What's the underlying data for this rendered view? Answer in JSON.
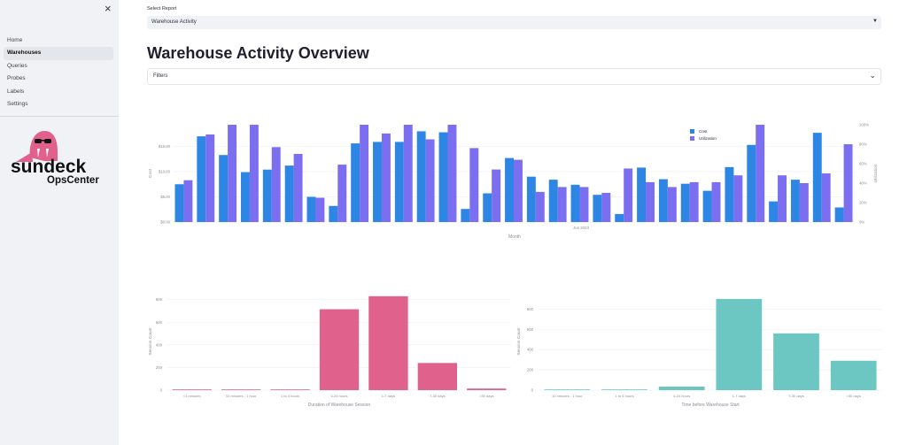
{
  "sidebar": {
    "items": [
      {
        "label": "Home",
        "active": false
      },
      {
        "label": "Warehouses",
        "active": true
      },
      {
        "label": "Queries",
        "active": false
      },
      {
        "label": "Probes",
        "active": false
      },
      {
        "label": "Labels",
        "active": false
      },
      {
        "label": "Settings",
        "active": false
      }
    ],
    "close_icon": "close-icon",
    "logo_word": "sundeck",
    "logo_sub": "OpsCenter"
  },
  "report": {
    "select_label": "Select Report",
    "selected": "Warehouse Activity"
  },
  "page_title": "Warehouse Activity Overview",
  "filters_label": "Filters",
  "colors": {
    "cost": "#2e86e4",
    "utilization": "#7b6ef0",
    "duration": "#e0618b",
    "start": "#6cc6c2",
    "grid": "#eceef2",
    "axis_text": "#8a8d96"
  },
  "chart_data": [
    {
      "type": "bar",
      "xlabel": "Month",
      "x_tick_label": "Jun 2023",
      "ylabel": "Cost",
      "y2label": "Utilization",
      "ylim": [
        0,
        19.3
      ],
      "y_ticks": [
        "$0.00",
        "$5.00",
        "$10.00",
        "$15.00"
      ],
      "y2lim": [
        0,
        100
      ],
      "y2_ticks": [
        "0%",
        "20%",
        "40%",
        "60%",
        "80%",
        "100%"
      ],
      "legend_position": "top-right",
      "series": [
        {
          "name": "Cost",
          "axis": "y",
          "values": [
            7.5,
            17.0,
            13.3,
            9.9,
            10.4,
            11.2,
            5.0,
            3.2,
            15.6,
            15.9,
            15.9,
            18.0,
            17.8,
            2.6,
            5.7,
            12.7,
            9.0,
            8.4,
            7.4,
            5.4,
            1.6,
            10.8,
            8.5,
            7.6,
            6.2,
            10.9,
            15.3,
            4.1,
            8.4,
            17.7,
            2.9
          ]
        },
        {
          "name": "Utilization",
          "axis": "y2",
          "values": [
            43,
            90,
            100,
            100,
            77,
            70,
            25,
            59,
            100,
            91,
            100,
            85,
            100,
            76,
            54,
            64,
            31,
            36,
            36,
            30,
            55,
            41,
            36,
            41,
            41,
            48,
            100,
            48,
            40,
            50,
            80
          ]
        }
      ]
    },
    {
      "type": "bar",
      "xlabel": "Duration of Warehouse Session",
      "ylabel": "Session Count",
      "ylim": [
        0,
        860
      ],
      "y_ticks": [
        "0",
        "200",
        "400",
        "600",
        "800"
      ],
      "categories": [
        "<1 minutes",
        "10 minutes - 1 hour",
        "1 to 4 hours",
        "4-24 hours",
        "1-7 days",
        "7-30 days",
        ">30 days"
      ],
      "values": [
        4,
        4,
        4,
        715,
        830,
        240,
        14
      ]
    },
    {
      "type": "bar",
      "xlabel": "Time before Warehouse Start",
      "ylabel": "Session Count",
      "ylim": [
        0,
        960
      ],
      "y_ticks": [
        "0",
        "200",
        "400",
        "600",
        "800"
      ],
      "categories": [
        "10 minutes - 1 hour",
        "1 to 4 hours",
        "4-24 hours",
        "1-7 days",
        "7-30 days",
        ">30 days"
      ],
      "values": [
        4,
        4,
        35,
        900,
        560,
        290
      ]
    }
  ]
}
